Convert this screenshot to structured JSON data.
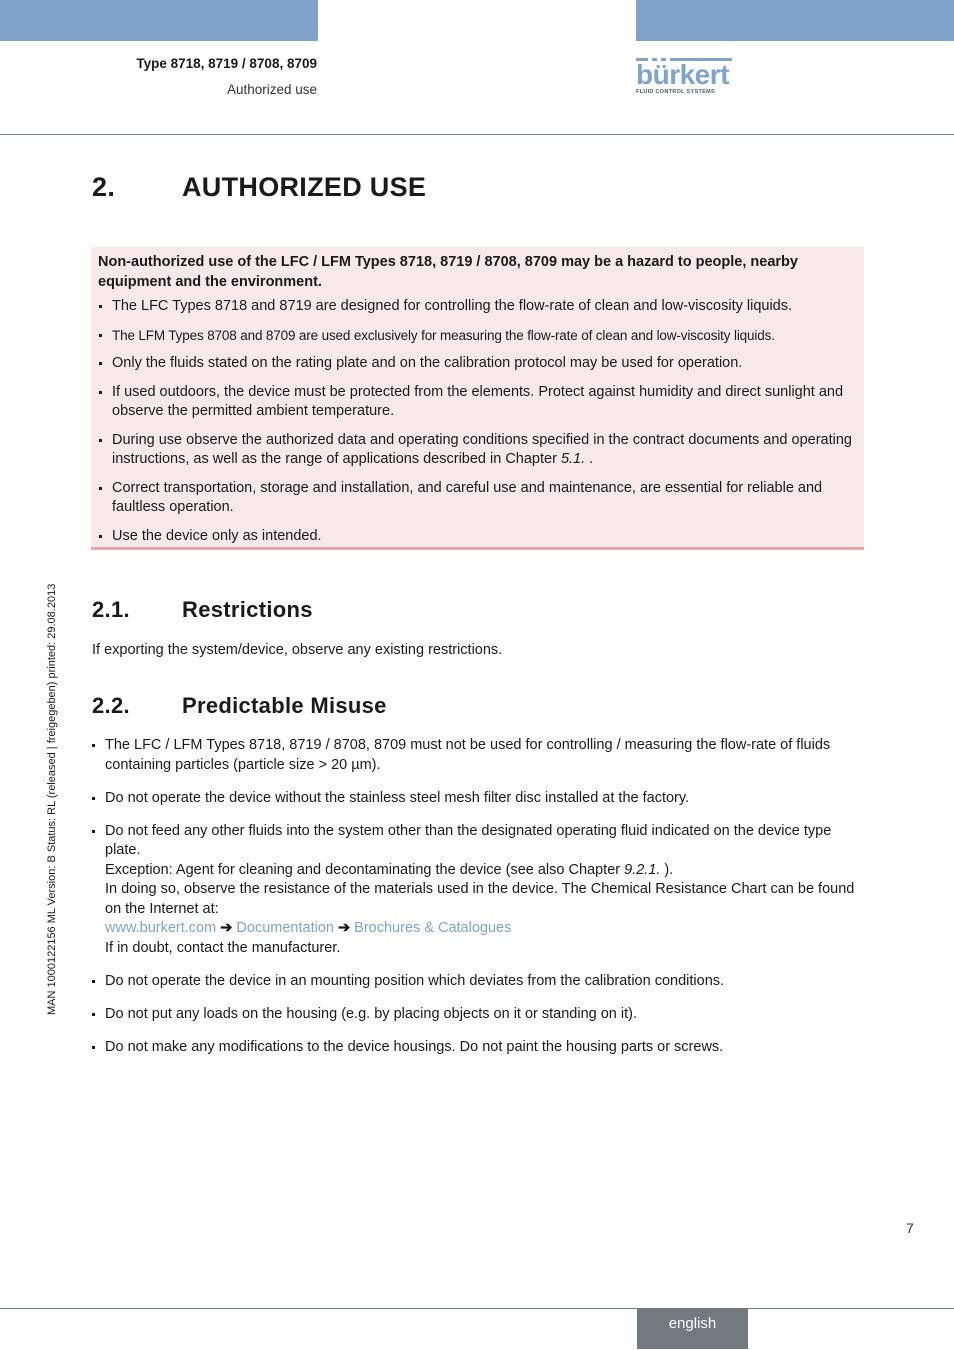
{
  "header": {
    "title": "Type 8718, 8719 / 8708, 8709",
    "subtitle": "Authorized use",
    "brand_colors": {
      "bar": "#7fa3c9",
      "footer_tab": "#73797f",
      "warning_bg": "#f7e9ea",
      "warning_border": "#e2a7a9",
      "link": "#7fa3c9"
    }
  },
  "logo": {
    "wordmark": "bürkert",
    "tagline": "FLUID CONTROL SYSTEMS"
  },
  "side_text": "MAN  1000122156  ML  Version: B  Status: RL (released | freigegeben)  printed: 29.08.2013",
  "chapter": {
    "number": "2.",
    "title": "AUTHORIZED USE"
  },
  "warning": {
    "heading": "Non-authorized use of the LFC / LFM Types 8718, 8719 / 8708, 8709 may be a hazard to people, nearby equipment and the environment.",
    "items": [
      "The LFC Types 8718 and 8719 are designed for controlling the flow-rate of clean and low-viscosity liquids.",
      "The LFM Types 8708 and 8709 are used exclusively for measuring the flow-rate of clean and low-viscosity liquids.",
      "Only the fluids stated on the rating plate and on the calibration protocol may be used for operation.",
      "If used outdoors, the device must be protected from the elements. Protect against humidity and direct sunlight and observe the permitted ambient temperature.",
      {
        "pre": "During use observe the authorized data and operating conditions specified in the contract documents and operating instructions, as well as the range of applications described in Chapter ",
        "ref": "5.1.",
        "post": " ."
      },
      "Correct transportation, storage and installation, and careful use and maintenance, are essential for reliable and faultless operation.",
      "Use the device only as intended."
    ]
  },
  "restrictions": {
    "number": "2.1.",
    "title": "Restrictions",
    "text": "If exporting the system/device, observe any existing restrictions."
  },
  "misuse": {
    "number": "2.2.",
    "title": "Predictable Misuse",
    "items": [
      "The LFC / LFM Types 8718, 8719 / 8708, 8709 must not be used for controlling / measuring the flow-rate of fluids containing particles (particle size > 20 µm).",
      "Do not operate the device without the stainless steel mesh filter disc installed at the factory.",
      {
        "line1": "Do not feed any other fluids into the system other than the designated operating fluid indicated on the device type plate.",
        "exception_pre": "Exception: Agent for cleaning and decontaminating the device (see also Chapter ",
        "exception_ref": "9.2.1.",
        "exception_post": " ).",
        "resistance": "In doing so, observe the resistance of the materials used in the device. The Chemical Resistance Chart can be found on the Internet at:",
        "links": [
          "www.burkert.com",
          "Documentation",
          "Brochures & Catalogues"
        ],
        "arrow": "➔",
        "doubt": "If in doubt, contact the manufacturer."
      },
      "Do not operate the device in an mounting position which deviates from the calibration conditions.",
      "Do not put any loads on the housing (e.g. by placing objects on it or standing on it).",
      "Do not make any modifications to the device housings. Do not paint the housing parts or screws."
    ]
  },
  "footer": {
    "page_number": "7",
    "language": "english"
  }
}
